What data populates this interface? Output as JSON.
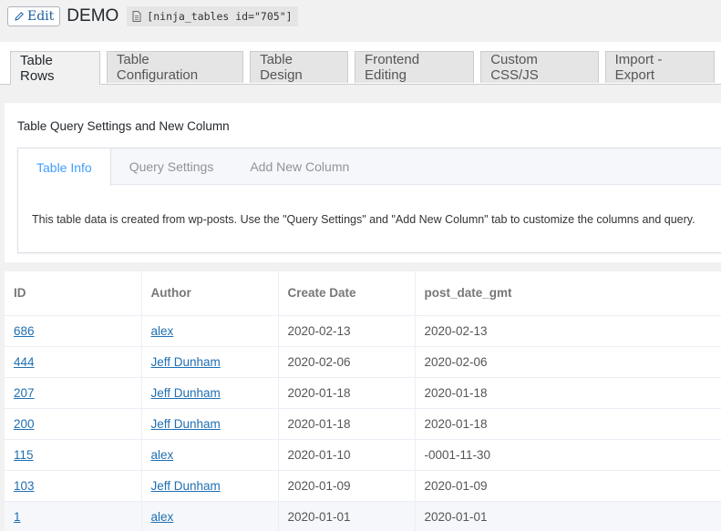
{
  "header": {
    "edit_label": "Edit",
    "title": "DEMO",
    "shortcode": "[ninja_tables id=\"705\"]"
  },
  "main_tabs": [
    {
      "label": "Table Rows",
      "active": true
    },
    {
      "label": "Table Configuration",
      "active": false
    },
    {
      "label": "Table Design",
      "active": false
    },
    {
      "label": "Frontend Editing",
      "active": false
    },
    {
      "label": "Custom CSS/JS",
      "active": false
    },
    {
      "label": "Import - Export",
      "active": false
    }
  ],
  "query_panel": {
    "title": "Table Query Settings and New Column",
    "tabs": [
      {
        "label": "Table Info",
        "active": true
      },
      {
        "label": "Query Settings",
        "active": false
      },
      {
        "label": "Add New Column",
        "active": false
      }
    ],
    "info_text": "This table data is created from wp-posts. Use the \"Query Settings\" and \"Add New Column\" tab to customize the columns and query."
  },
  "table": {
    "columns": [
      "ID",
      "Author",
      "Create Date",
      "post_date_gmt"
    ],
    "rows": [
      {
        "id": "686",
        "author": "alex",
        "create_date": "2020-02-13",
        "gmt": "2020-02-13"
      },
      {
        "id": "444",
        "author": "Jeff Dunham",
        "create_date": "2020-02-06",
        "gmt": "2020-02-06"
      },
      {
        "id": "207",
        "author": "Jeff Dunham",
        "create_date": "2020-01-18",
        "gmt": "2020-01-18"
      },
      {
        "id": "200",
        "author": "Jeff Dunham",
        "create_date": "2020-01-18",
        "gmt": "2020-01-18"
      },
      {
        "id": "115",
        "author": "alex",
        "create_date": "2020-01-10",
        "gmt": "-0001-11-30"
      },
      {
        "id": "103",
        "author": "Jeff Dunham",
        "create_date": "2020-01-09",
        "gmt": "2020-01-09"
      },
      {
        "id": "1",
        "author": "alex",
        "create_date": "2020-01-01",
        "gmt": "2020-01-01"
      }
    ]
  },
  "colors": {
    "link": "#1f6fb2",
    "active_inner_tab": "#409eff",
    "page_bg": "#f1f1f1"
  },
  "icons": {
    "edit": "pencil-icon",
    "shortcode": "document-icon"
  }
}
